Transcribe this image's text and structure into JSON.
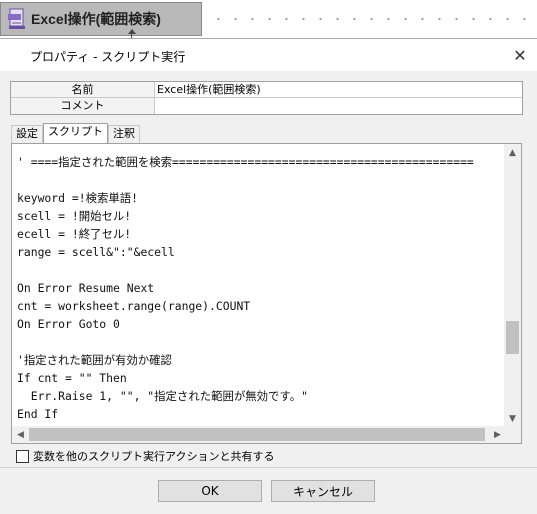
{
  "node": {
    "label": "Excel操作(範囲検索)",
    "icon": "script-file-icon"
  },
  "dialog": {
    "title": "プロパティ - スクリプト実行",
    "close_glyph": "✕"
  },
  "properties": [
    {
      "key": "名前",
      "value": "Excel操作(範囲検索)"
    },
    {
      "key": "コメント",
      "value": ""
    }
  ],
  "tabs": [
    {
      "label": "設定",
      "active": false
    },
    {
      "label": "スクリプト",
      "active": true
    },
    {
      "label": "注釈",
      "active": false
    }
  ],
  "script_lines": [
    "' ====指定された範囲を検索============================================",
    "",
    "keyword =!検索単語!",
    "scell = !開始セル!",
    "ecell = !終了セル!",
    "range = scell&\":\"&ecell",
    "",
    "On Error Resume Next",
    "cnt = worksheet.range(range).COUNT",
    "On Error Goto 0",
    "",
    "'指定された範囲が有効か確認",
    "If cnt = \"\" Then",
    "  Err.Raise 1, \"\", \"指定された範囲が無効です。\"",
    "End If"
  ],
  "share_checkbox": {
    "label": "変数を他のスクリプト実行アクションと共有する",
    "checked": false
  },
  "buttons": {
    "ok": "OK",
    "cancel": "キャンセル"
  }
}
